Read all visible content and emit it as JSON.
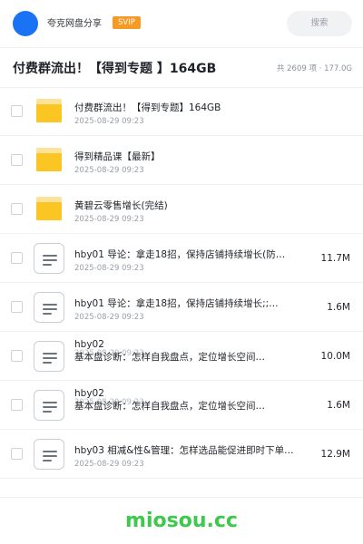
{
  "header": {
    "username": "夸克网盘分享",
    "badge": "SVIP",
    "search_placeholder": "搜索"
  },
  "title": {
    "text": "付费群流出！【得到专题 】164GB",
    "stats": "共 2609 项 · 177.0G"
  },
  "files": [
    {
      "type": "folder",
      "name": "付费群流出！【得到专题】164GB",
      "date": "2025-08-29 09:23",
      "size": ""
    },
    {
      "type": "folder",
      "name": "得到精品课【最新】",
      "date": "2025-08-29 09:23",
      "size": ""
    },
    {
      "type": "folder",
      "name": "黄碧云零售增长(完结)",
      "date": "2025-08-29 09:23",
      "size": ""
    },
    {
      "type": "doc",
      "name": "hby01 导论：拿走18招，保持店铺持续增长(防…",
      "date": "2025-08-29 09:23",
      "size": "11.7M"
    },
    {
      "type": "doc",
      "name": "hby01 导论：拿走18招，保持店铺持续增长;;…",
      "date": "2025-08-29 09:23",
      "size": "1.6M"
    },
    {
      "type": "doc2",
      "name_line1": "hby02",
      "name_line2": "基本盘诊断：怎样自我盘点，定位增长空间…",
      "date": "2025-08-29 09:23",
      "size": "10.0M"
    },
    {
      "type": "doc2",
      "name_line1": "hby02",
      "name_line2": "基本盘诊断：怎样自我盘点，定位增长空间…",
      "date": "2025-08-29 09:23",
      "size": "1.6M"
    },
    {
      "type": "doc",
      "name": "hby03 相减&性&管理：怎样选品能促进即时下单…",
      "date": "2025-08-29 09:23",
      "size": "12.9M"
    }
  ],
  "watermark": "miosou.cc",
  "colors": {
    "accent": "#1a73f5",
    "svip": "#f59a23",
    "folder": "#fbc524",
    "watermark": "#3cc94c"
  }
}
